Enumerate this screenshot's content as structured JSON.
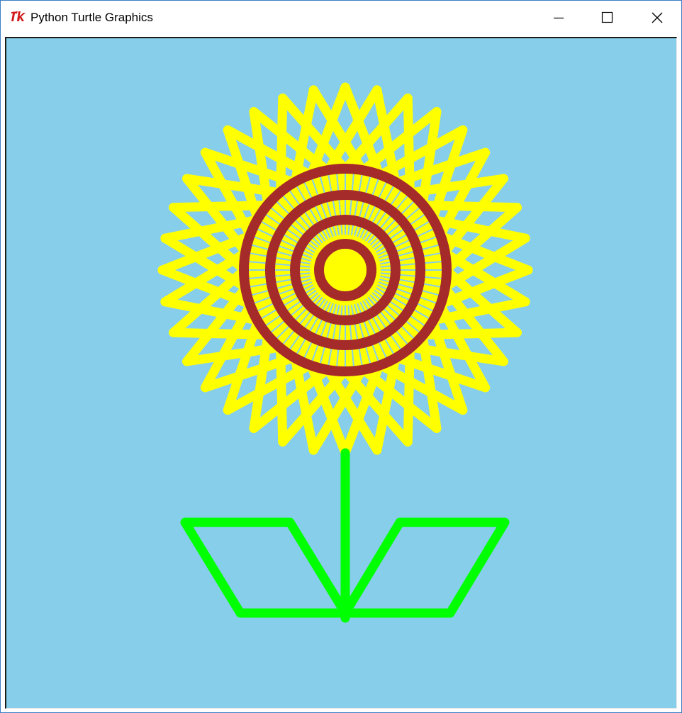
{
  "window": {
    "title": "Python Turtle Graphics",
    "app_icon": "tk-feather-icon",
    "controls": [
      "minimize-icon",
      "maximize-icon",
      "close-icon"
    ]
  },
  "canvas": {
    "background": "#87ceeb",
    "petal_color": "#ffff00",
    "center_color": "#ffff00",
    "ring_color": "#a52a2a",
    "stem_color": "#00ff00",
    "leaf_color": "#00ff00",
    "petal_star_points": 36,
    "ring_count": 4,
    "leaf_count": 2
  }
}
